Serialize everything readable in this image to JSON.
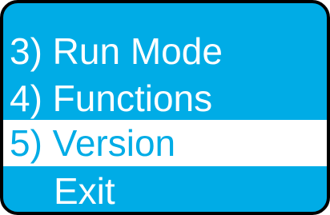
{
  "menu": {
    "items": [
      {
        "label": "3) Run Mode",
        "selected": false
      },
      {
        "label": "4) Functions",
        "selected": false
      },
      {
        "label": "5) Version",
        "selected": true
      },
      {
        "label": "Exit",
        "selected": false
      }
    ]
  },
  "colors": {
    "background": "#00ace6",
    "text": "#ffffff",
    "highlight_background": "#ffffff",
    "highlight_text": "#00ace6",
    "border": "#000000"
  }
}
